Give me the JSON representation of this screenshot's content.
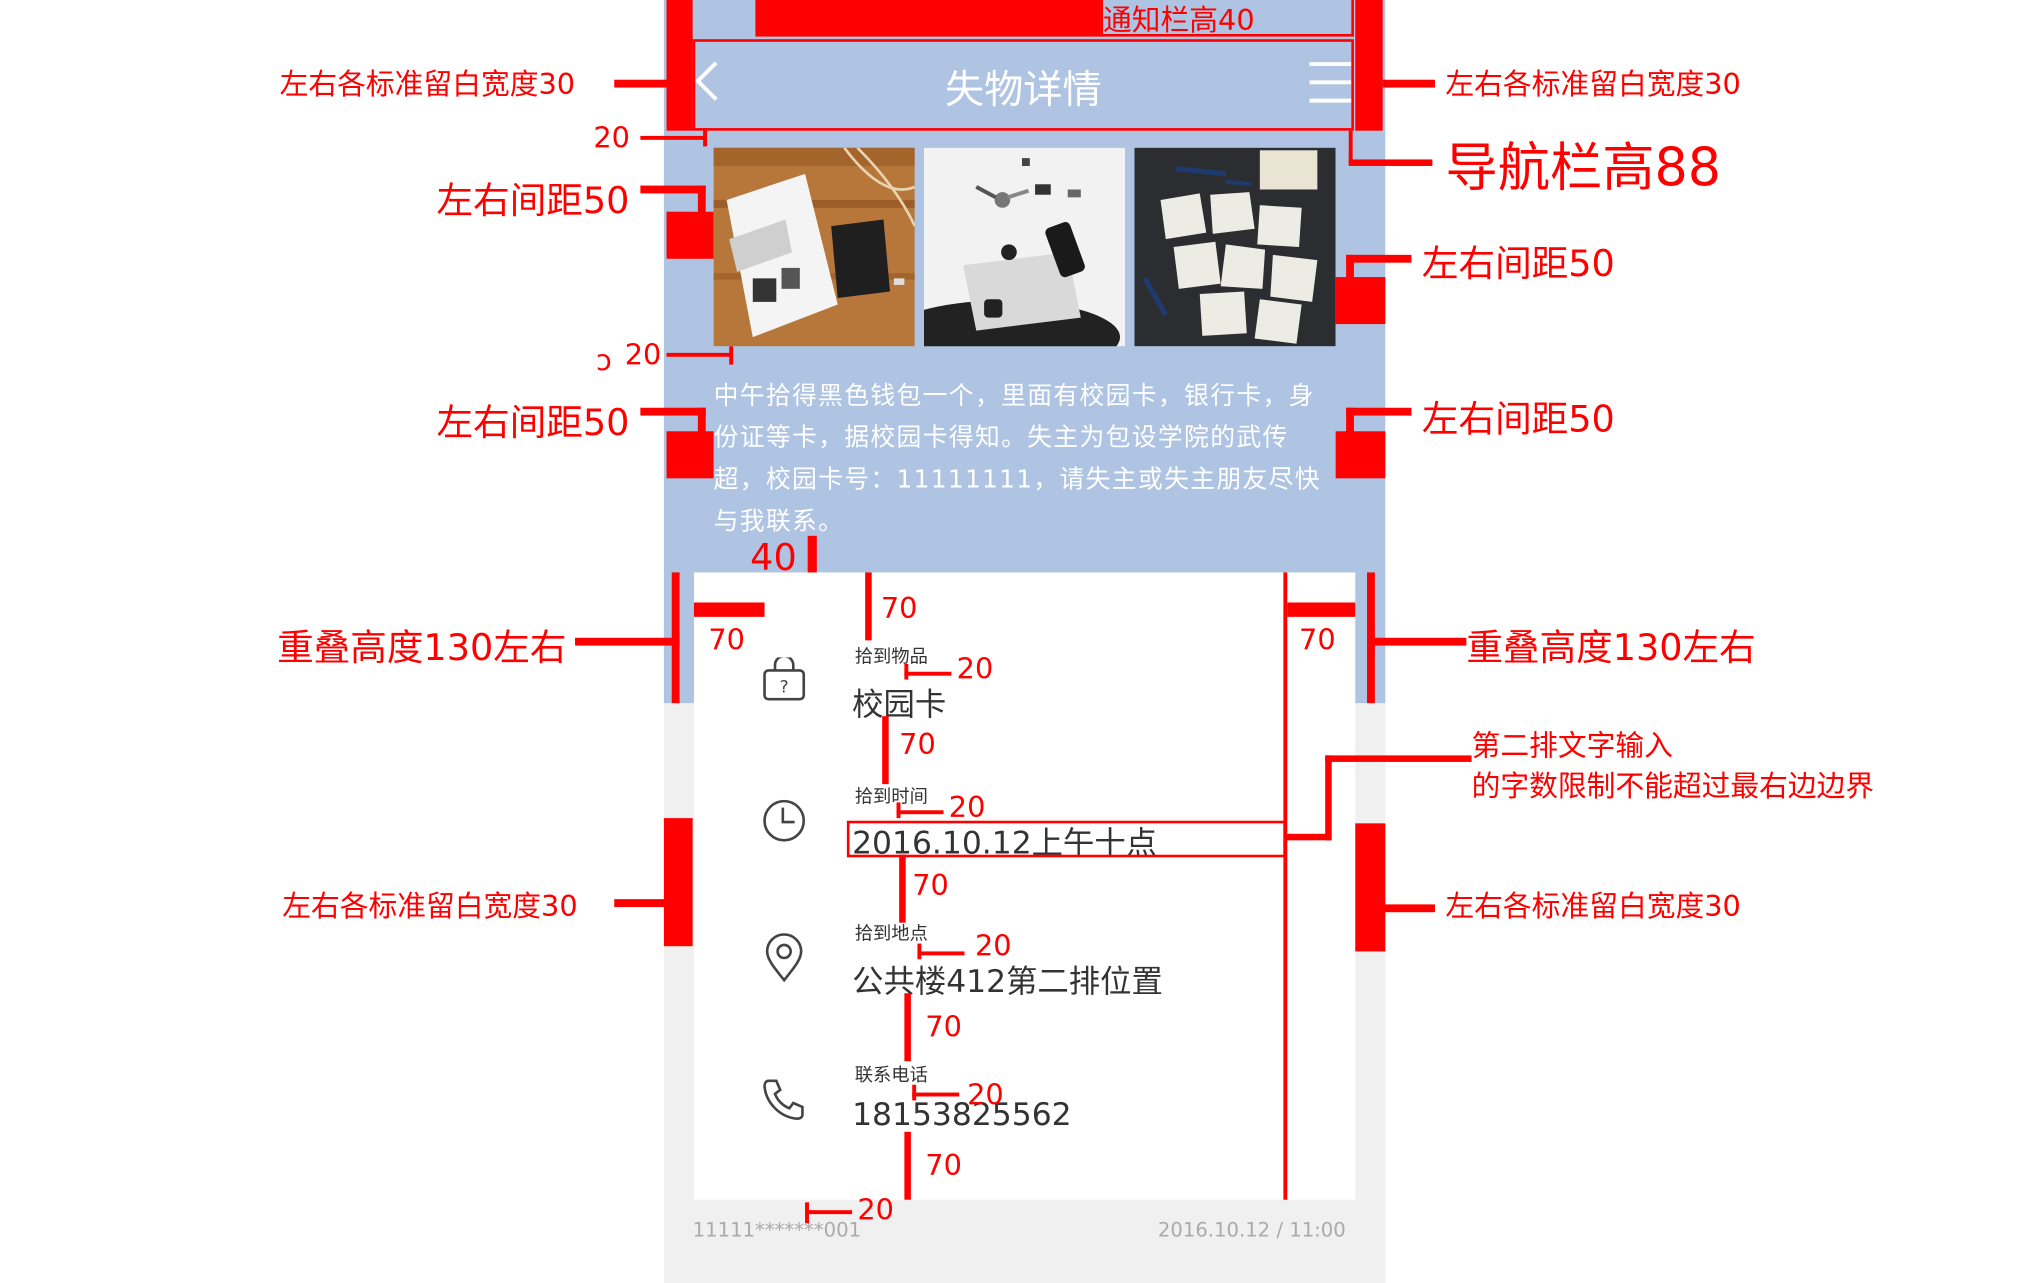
{
  "colors": {
    "accent": "#aec4e2",
    "annotation": "#ff0000"
  },
  "nav": {
    "title": "失物详情",
    "back_icon": "chevron-left-icon",
    "menu_icon": "menu-icon"
  },
  "photos": [
    {
      "name": "photo-notebook",
      "desc": "notebook on wooden desk"
    },
    {
      "name": "photo-keys",
      "desc": "keys and phone on white"
    },
    {
      "name": "photo-notes",
      "desc": "sticky notes on dark table"
    }
  ],
  "description": "中午拾得黑色钱包一个，里面有校园卡，银行卡，身份证等卡，据校园卡得知。失主为包设学院的武传超，校园卡号：11111111，请失主或失主朋友尽快与我联系。",
  "info": {
    "item": {
      "label": "拾到物品",
      "value": "校园卡"
    },
    "time": {
      "label": "拾到时间",
      "value": "2016.10.12上午十点"
    },
    "place": {
      "label": "拾到地点",
      "value": "公共楼412第二排位置"
    },
    "phone": {
      "label": "联系电话",
      "value": "18153825562"
    }
  },
  "footer": {
    "user": "11111*******001",
    "datetime": "2016.10.12 / 11:00"
  },
  "annotations": {
    "status_bar": "通知栏高40",
    "margin30": "左右各标准留白宽度30",
    "nav_height": "导航栏高88",
    "spacing50": "左右间距50",
    "overlap": "重叠高度130左右",
    "text_limit_1": "第二排文字输入",
    "text_limit_2": "的字数限制不能超过最右边边界",
    "n20": "20",
    "n40": "40",
    "n70": "70",
    "artifact": "ɔ"
  }
}
